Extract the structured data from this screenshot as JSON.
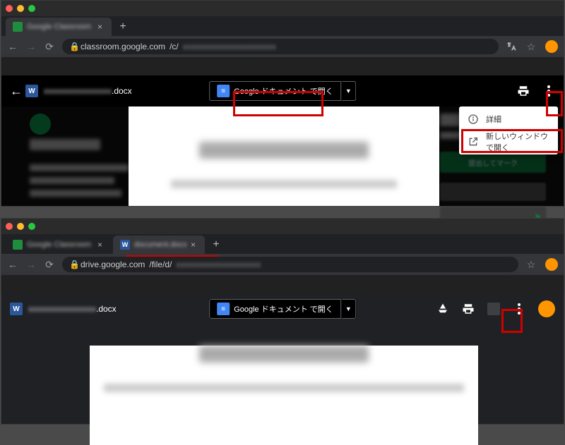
{
  "top": {
    "tab": {
      "label": "Google Classroom"
    },
    "address": {
      "host": "classroom.google.com",
      "path": "/c/"
    },
    "doc": {
      "name_suffix": ".docx"
    },
    "open_with": {
      "label": "Google ドキュメント で開く"
    },
    "menu": {
      "details": "詳細",
      "open_new_window": "新しいウィンドウで開く"
    },
    "assignment": {
      "mark_button": "提出してマーク"
    }
  },
  "bottom": {
    "tab1": {
      "label": "Google Classroom"
    },
    "tab2": {
      "label": "document.docx"
    },
    "address": {
      "host": "drive.google.com",
      "path": "/file/d/"
    },
    "doc": {
      "name_suffix": ".docx"
    },
    "open_with": {
      "label": "Google ドキュメント で開く"
    }
  },
  "colors": {
    "highlight": "#d10000"
  }
}
